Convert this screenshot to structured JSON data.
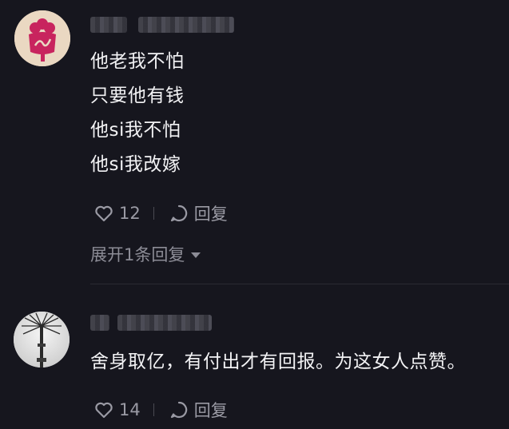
{
  "comments": [
    {
      "lines": [
        "他老我不怕",
        "只要他有钱",
        "他si我不怕",
        "他si我改嫁"
      ],
      "likes": "12",
      "reply_label": "回复",
      "expand_label": "展开1条回复"
    },
    {
      "lines": [
        "舍身取亿，有付出才有回报。为这女人点赞。"
      ],
      "likes": "14",
      "reply_label": "回复"
    }
  ],
  "icons": {
    "like": "heart-outline-icon",
    "reply": "speech-bubble-icon",
    "expand": "caret-down-icon"
  },
  "colors": {
    "background": "#16161e",
    "text": "#f2f2f4",
    "secondary": "#9a9aa4"
  }
}
